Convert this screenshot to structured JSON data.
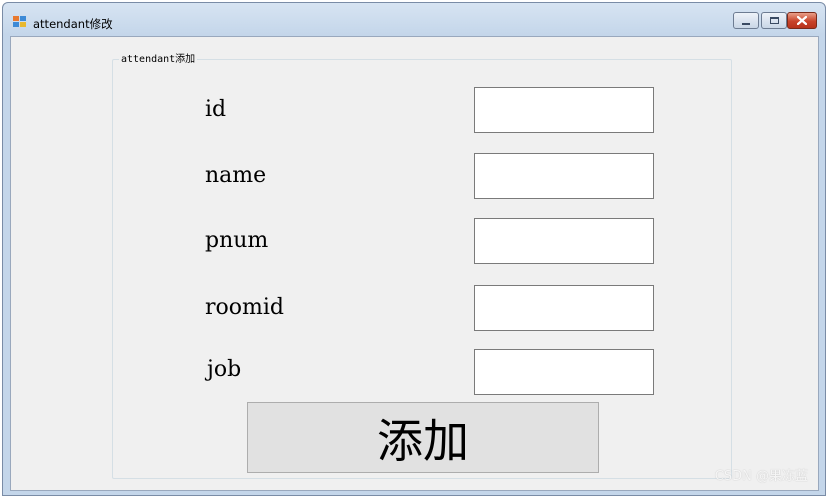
{
  "window": {
    "title": "attendant修改",
    "icon": "windows-form-icon",
    "caption_buttons": {
      "minimize_icon": "minimize-icon",
      "maximize_icon": "maximize-icon",
      "close_icon": "close-icon"
    }
  },
  "groupbox": {
    "legend": "attendant添加"
  },
  "fields": [
    {
      "label": "id",
      "value": ""
    },
    {
      "label": "name",
      "value": ""
    },
    {
      "label": "pnum",
      "value": ""
    },
    {
      "label": "roomid",
      "value": ""
    },
    {
      "label": "job",
      "value": ""
    }
  ],
  "submit": {
    "label": "添加"
  },
  "watermark": "CSDN @果冻蓝"
}
